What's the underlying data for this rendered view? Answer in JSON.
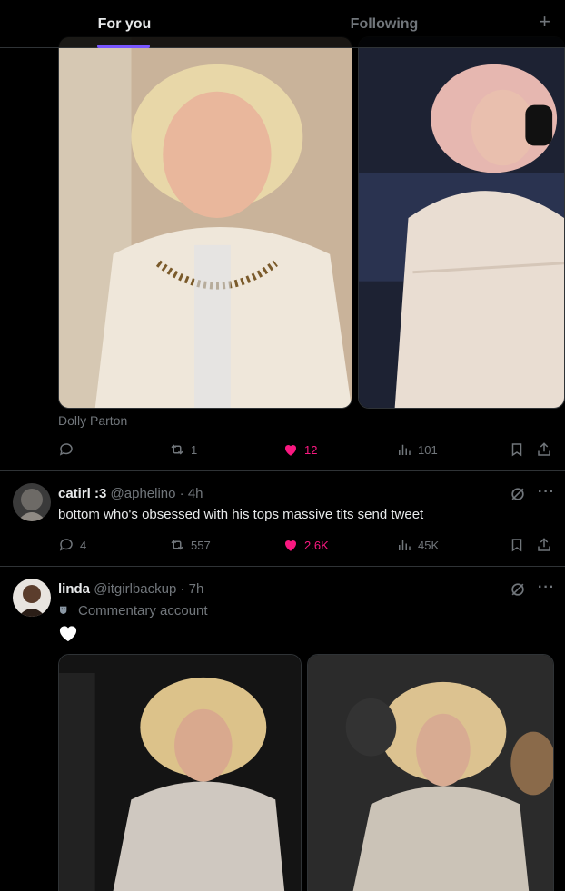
{
  "header": {
    "tabs": [
      {
        "label": "For you",
        "active": true
      },
      {
        "label": "Following",
        "active": false
      }
    ],
    "add_icon": "plus-icon",
    "accent_color": "#7856ff"
  },
  "post1": {
    "caption": "Dolly Parton",
    "actions": {
      "replies": "",
      "reposts": "1",
      "likes": "12",
      "views": "101",
      "liked": true
    }
  },
  "post2": {
    "display_name": "catirl :3",
    "handle": "@aphelino",
    "time": "4h",
    "text": "bottom who's obsessed with his tops massive tits send tweet",
    "actions": {
      "replies": "4",
      "reposts": "557",
      "likes": "2.6K",
      "views": "45K",
      "liked": true
    }
  },
  "post3": {
    "display_name": "linda",
    "handle": "@itgirlbackup",
    "time": "7h",
    "badge": "Commentary account",
    "text_emoji": "white-heart"
  },
  "colors": {
    "like": "#f91880",
    "muted": "#71767b",
    "text": "#e7e9ea",
    "border": "#2f3336"
  }
}
